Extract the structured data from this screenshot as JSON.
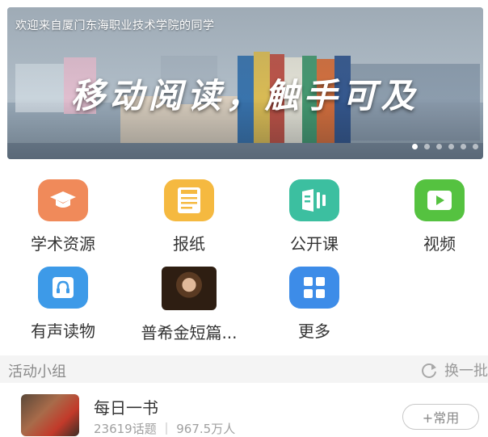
{
  "banner": {
    "welcome_text": "欢迎来自厦门东海职业技术学院的同学",
    "slogan": "移动阅读，触手可及",
    "dots_count": 6,
    "active_dot": 0
  },
  "grid": {
    "items": [
      {
        "label": "学术资源",
        "icon": "graduation-cap-icon",
        "color": "#f08a5a"
      },
      {
        "label": "报纸",
        "icon": "newspaper-icon",
        "color": "#f5b940"
      },
      {
        "label": "公开课",
        "icon": "open-course-icon",
        "color": "#3cbfa0"
      },
      {
        "label": "视频",
        "icon": "video-play-icon",
        "color": "#55c240"
      },
      {
        "label": "有声读物",
        "icon": "headphones-book-icon",
        "color": "#3d9ae8"
      },
      {
        "label": "普希金短篇...",
        "icon": "portrait-image",
        "color": "#4a2e1c"
      },
      {
        "label": "更多",
        "icon": "more-grid-icon",
        "color": "#3d8ce8"
      }
    ]
  },
  "section": {
    "title": "活动小组",
    "refresh_label": "换一批",
    "refresh_icon": "refresh-icon"
  },
  "group": {
    "name": "每日一书",
    "meta": "23619话题 ｜ 967.5万人",
    "button_label": "+常用"
  }
}
